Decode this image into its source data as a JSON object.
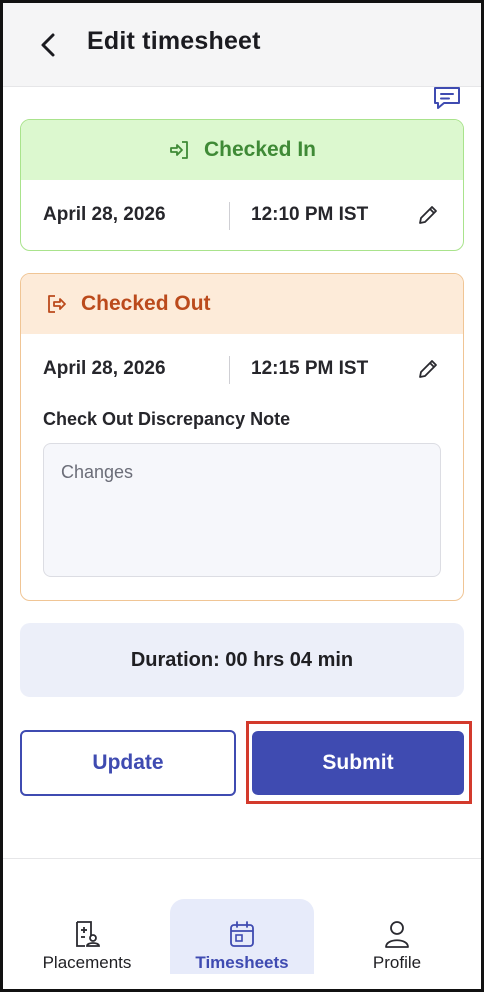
{
  "header": {
    "title": "Edit timesheet",
    "back_icon": "chevron-left-icon"
  },
  "comment_icon": "chat-lines-icon",
  "checked_in": {
    "label": "Checked In",
    "icon": "login-arrow-icon",
    "date": "April 28, 2026",
    "time": "12:10 PM IST",
    "accent": "#3f8a36",
    "background": "#dcf8cf"
  },
  "checked_out": {
    "label": "Checked Out",
    "icon": "logout-arrow-icon",
    "date": "April 28, 2026",
    "time": "12:15 PM IST",
    "accent": "#bb4a1c",
    "background": "#fdebd9",
    "note_label": "Check Out Discrepancy Note",
    "note_value": "Changes"
  },
  "duration": {
    "text": "Duration: 00 hrs 04 min"
  },
  "actions": {
    "update_label": "Update",
    "submit_label": "Submit",
    "primary_color": "#3f4bb1"
  },
  "bottom_nav": {
    "items": [
      {
        "label": "Placements",
        "icon": "placements-icon",
        "active": false
      },
      {
        "label": "Timesheets",
        "icon": "calendar-icon",
        "active": true
      },
      {
        "label": "Profile",
        "icon": "person-icon",
        "active": false
      }
    ]
  }
}
